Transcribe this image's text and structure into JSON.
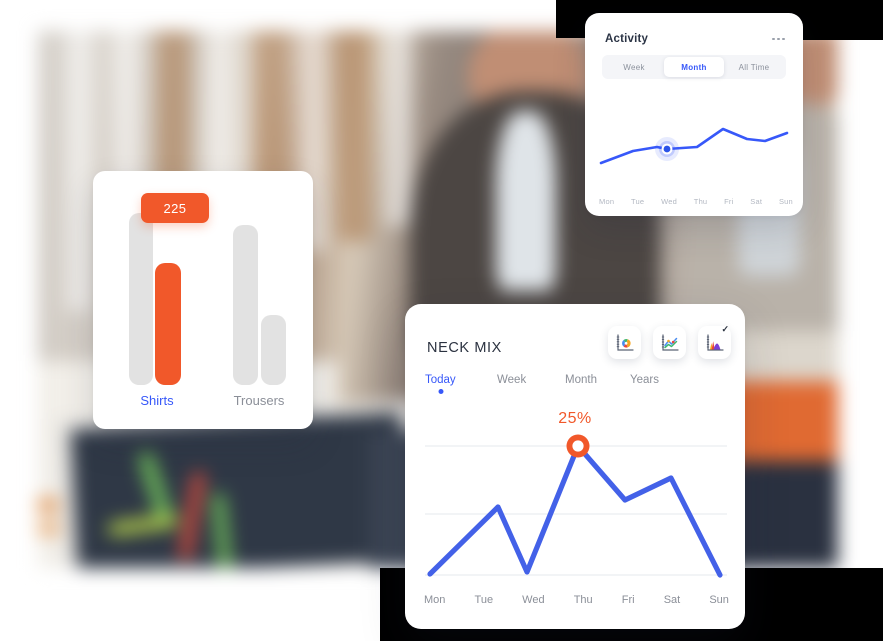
{
  "activity_card": {
    "title": "Activity",
    "menu_icon": "more-horizontal-icon",
    "segments": [
      {
        "label": "Week",
        "active": false
      },
      {
        "label": "Month",
        "active": true
      },
      {
        "label": "All Time",
        "active": false
      }
    ],
    "days": [
      "Mon",
      "Tue",
      "Wed",
      "Thu",
      "Fri",
      "Sat",
      "Sun"
    ],
    "colors": {
      "line": "#3758f9",
      "marker": "#2b53e8",
      "active_text": "#3758f9"
    }
  },
  "bar_card": {
    "tooltip_value": "225",
    "categories": [
      {
        "label": "Shirts",
        "selected": true
      },
      {
        "label": "Trousers",
        "selected": false
      }
    ],
    "colors": {
      "bar_grey": "#e2e2e2",
      "bar_orange": "#f1582a",
      "selected_label": "#3758f9"
    }
  },
  "neck_card": {
    "title": "NECK MIX",
    "icons": [
      {
        "name": "donut-chart-icon",
        "checked": false
      },
      {
        "name": "line-chart-icon",
        "checked": false
      },
      {
        "name": "area-chart-icon",
        "checked": true
      }
    ],
    "tabs": [
      {
        "label": "Today",
        "active": true
      },
      {
        "label": "Week",
        "active": false
      },
      {
        "label": "Month",
        "active": false
      },
      {
        "label": "Years",
        "active": false
      }
    ],
    "highlight_value": "25%",
    "days": [
      "Mon",
      "Tue",
      "Wed",
      "Thu",
      "Fri",
      "Sat",
      "Sun"
    ],
    "colors": {
      "line": "#4361e8",
      "marker_ring": "#f1582a",
      "highlight_text": "#f1582a"
    }
  },
  "chart_data": [
    {
      "type": "line",
      "title": "Activity",
      "chart_id": "activity-sparkline",
      "categories": [
        "Mon",
        "Tue",
        "Wed",
        "Thu",
        "Fri",
        "Sat",
        "Sun"
      ],
      "values": [
        18,
        36,
        30,
        30,
        58,
        36,
        46
      ],
      "ylim": [
        0,
        70
      ],
      "grid": false,
      "legend": "none",
      "xlabel": "",
      "ylabel": "",
      "marker_at": "Wed",
      "marker_value": 30
    },
    {
      "type": "bar",
      "title": "",
      "chart_id": "shirts-trousers-bars",
      "categories": [
        "Shirts",
        "Trousers"
      ],
      "series": [
        {
          "name": "Total",
          "values": [
            225,
            160
          ],
          "color": "#e2e2e2"
        },
        {
          "name": "Selected",
          "values": [
            225,
            60
          ],
          "color": "#f1582a"
        }
      ],
      "bars": [
        {
          "category": "Shirts",
          "series": "Total",
          "value": 178,
          "color": "#e2e2e2"
        },
        {
          "category": "Shirts",
          "series": "Selected",
          "value": 135,
          "color": "#f1582a",
          "label": "225"
        },
        {
          "category": "Trousers",
          "series": "Total",
          "value": 164,
          "color": "#e2e2e2"
        },
        {
          "category": "Trousers",
          "series": "Selected",
          "value": 75,
          "color": "#e2e2e2"
        }
      ],
      "ylim": [
        0,
        230
      ],
      "grid": false,
      "data_label": "225",
      "xlabel": "",
      "ylabel": ""
    },
    {
      "type": "line",
      "title": "NECK MIX",
      "chart_id": "neck-mix-line",
      "categories": [
        "Mon",
        "Tue",
        "Wed",
        "Thu",
        "Fri",
        "Sat",
        "Sun"
      ],
      "values": [
        2,
        48,
        4,
        100,
        58,
        78,
        0
      ],
      "ylim": [
        0,
        110
      ],
      "grid": true,
      "gridlines": [
        26,
        70
      ],
      "legend": "none",
      "xlabel": "",
      "ylabel": "",
      "marker_at": "Thu",
      "marker_value": 100,
      "annotation": "25%"
    }
  ]
}
